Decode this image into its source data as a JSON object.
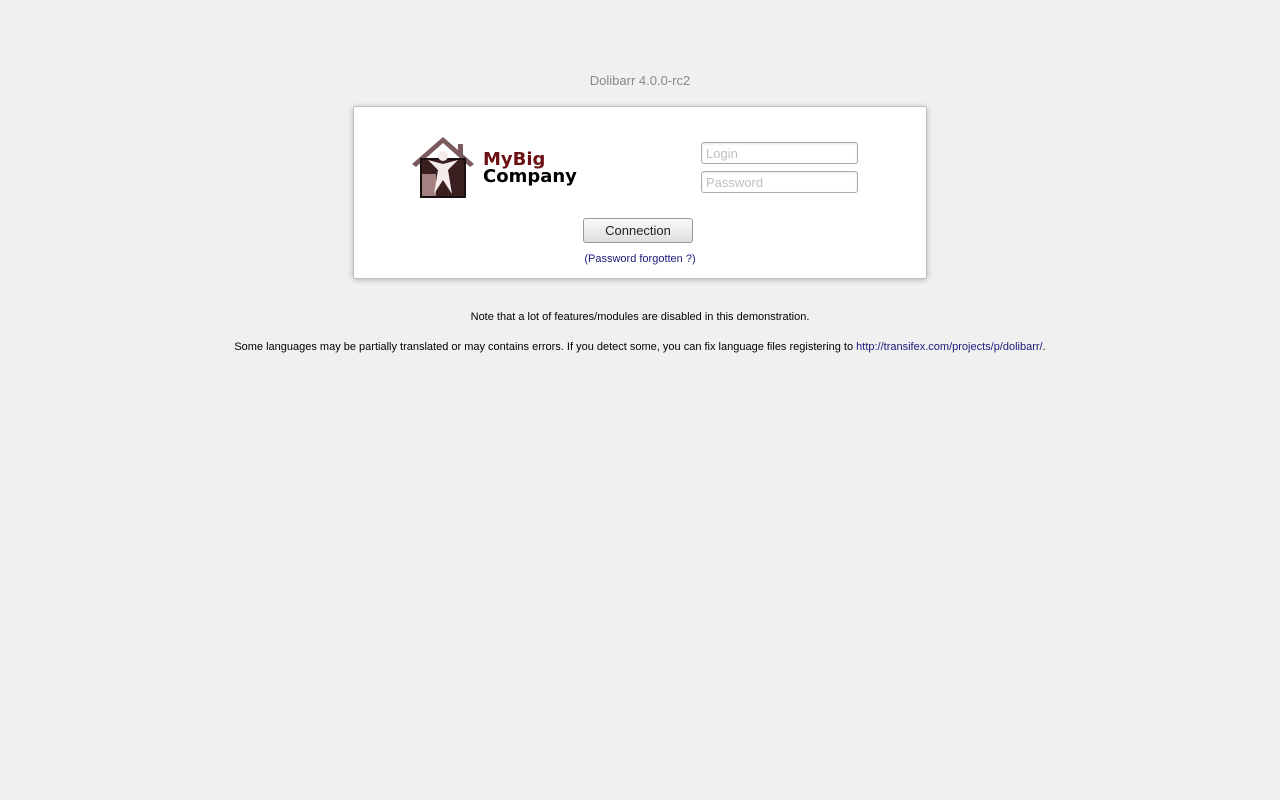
{
  "header": {
    "version_title": "Dolibarr 4.0.0-rc2"
  },
  "logo": {
    "icon": "house-person-icon",
    "line1": "MyBig",
    "line2": "Company"
  },
  "form": {
    "login_placeholder": "Login",
    "password_placeholder": "Password",
    "login_value": "",
    "password_value": "",
    "connect_label": "Connection",
    "forgot_label": "(Password forgotten ?)"
  },
  "notes": {
    "demo_note": "Note that a lot of features/modules are disabled in this demonstration.",
    "lang_note_prefix": "Some languages may be partially translated or may contains errors. If you detect some, you can fix language files registering to ",
    "lang_note_link": "http://transifex.com/projects/p/dolibarr/",
    "lang_note_suffix": "."
  },
  "colors": {
    "background": "#f0f0f0",
    "logo_accent": "#6b0f12",
    "link": "#1a1a7a"
  }
}
